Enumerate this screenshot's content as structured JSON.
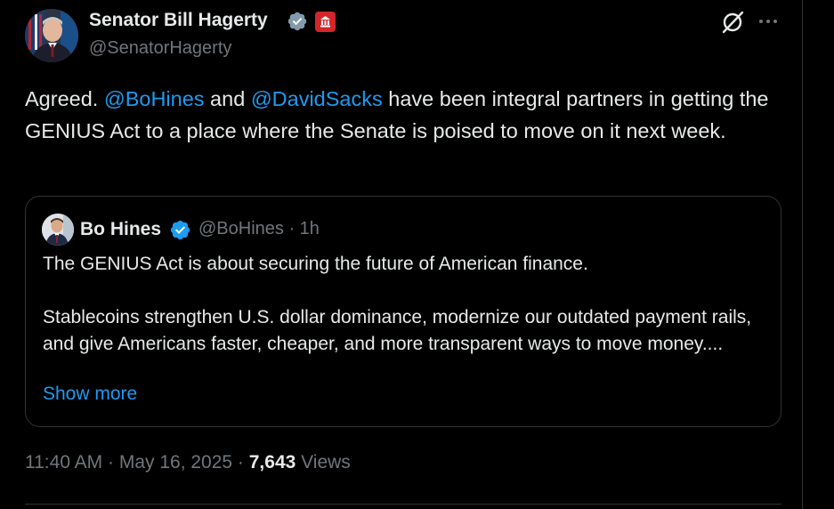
{
  "colors": {
    "background": "#000000",
    "text_primary": "#e7e9ea",
    "text_secondary": "#71767b",
    "link": "#1d9bf0",
    "border": "#2f3336",
    "verified_badge": "#829aab",
    "quoted_verified_badge": "#1d9bf0",
    "government_badge": "#d3262c"
  },
  "icons": {
    "verified": "verified-checkmark-icon",
    "government": "government-label-icon",
    "grok": "grok-icon",
    "more": "more-options-icon"
  },
  "tweet": {
    "author": {
      "name": "Senator Bill Hagerty",
      "handle": "@SenatorHagerty"
    },
    "text": {
      "part1": "Agreed. ",
      "mention1": "@BoHines",
      "part2": " and ",
      "mention2": "@DavidSacks",
      "part3": " have been integral partners in getting the GENIUS Act to a place where the Senate is poised to move on it next week."
    },
    "quoted": {
      "author_name": "Bo Hines",
      "meta": "@BoHines · 1h",
      "paragraph1": "The GENIUS Act is about securing the future of American finance.",
      "paragraph2": "Stablecoins strengthen U.S. dollar dominance, modernize our outdated payment rails, and give Americans faster, cheaper, and more transparent ways to move money....",
      "show_more": "Show more"
    },
    "timestamp": "11:40 AM · May 16, 2025 · ",
    "views_count": "7,643",
    "views_label": " Views"
  }
}
